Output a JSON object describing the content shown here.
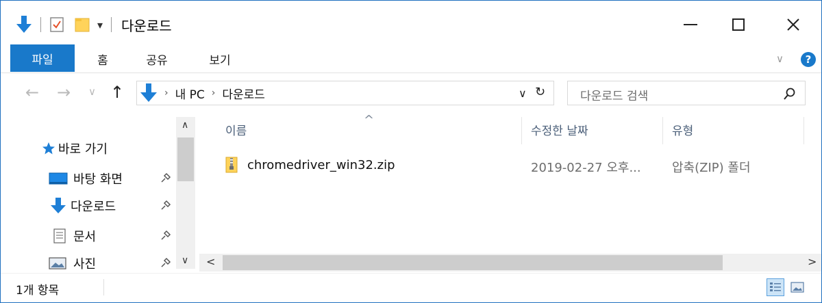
{
  "window": {
    "title": "다운로드",
    "accent": "#1979CA"
  },
  "quick_access": {
    "icons": [
      "download-arrow-icon",
      "properties-check-icon",
      "new-folder-icon",
      "customize-dropdown-icon"
    ],
    "dropdown_glyph": "▾"
  },
  "window_controls": {
    "minimize_glyph": "—",
    "maximize_glyph": "☐",
    "close_glyph": "✕"
  },
  "ribbon": {
    "tabs": [
      {
        "label": "파일"
      },
      {
        "label": "홈"
      },
      {
        "label": "공유"
      },
      {
        "label": "보기"
      }
    ],
    "collapse_glyph": "∨",
    "help_glyph": "?"
  },
  "nav": {
    "back_glyph": "←",
    "forward_glyph": "→",
    "recent_glyph": "∨",
    "up_glyph": "↑"
  },
  "address": {
    "breadcrumbs": [
      "내 PC",
      "다운로드"
    ],
    "separator": "›",
    "dropdown_glyph": "∨",
    "refresh_glyph": "↻"
  },
  "search": {
    "placeholder": "다운로드 검색",
    "icon": "search-icon"
  },
  "sidebar": {
    "items": [
      {
        "label": "바로 가기",
        "icon": "star-icon",
        "pinned": false
      },
      {
        "label": "바탕 화면",
        "icon": "desktop-icon",
        "pinned": true
      },
      {
        "label": "다운로드",
        "icon": "download-arrow-icon",
        "pinned": true
      },
      {
        "label": "문서",
        "icon": "document-icon",
        "pinned": true
      },
      {
        "label": "사진",
        "icon": "pictures-icon",
        "pinned": true
      }
    ],
    "scroll_up_glyph": "∧",
    "scroll_down_glyph": "∨"
  },
  "file_list": {
    "columns": [
      "이름",
      "수정한 날짜",
      "유형"
    ],
    "sort_glyph": "^",
    "rows": [
      {
        "name": "chromedriver_win32.zip",
        "modified": "2019-02-27 오후...",
        "type": "압축(ZIP) 폴더",
        "icon": "zip-folder-icon"
      }
    ],
    "scroll_left_glyph": "<",
    "scroll_right_glyph": ">"
  },
  "status": {
    "item_count": "1개 항목",
    "views": [
      "details-view-icon",
      "large-icons-view-icon"
    ]
  }
}
